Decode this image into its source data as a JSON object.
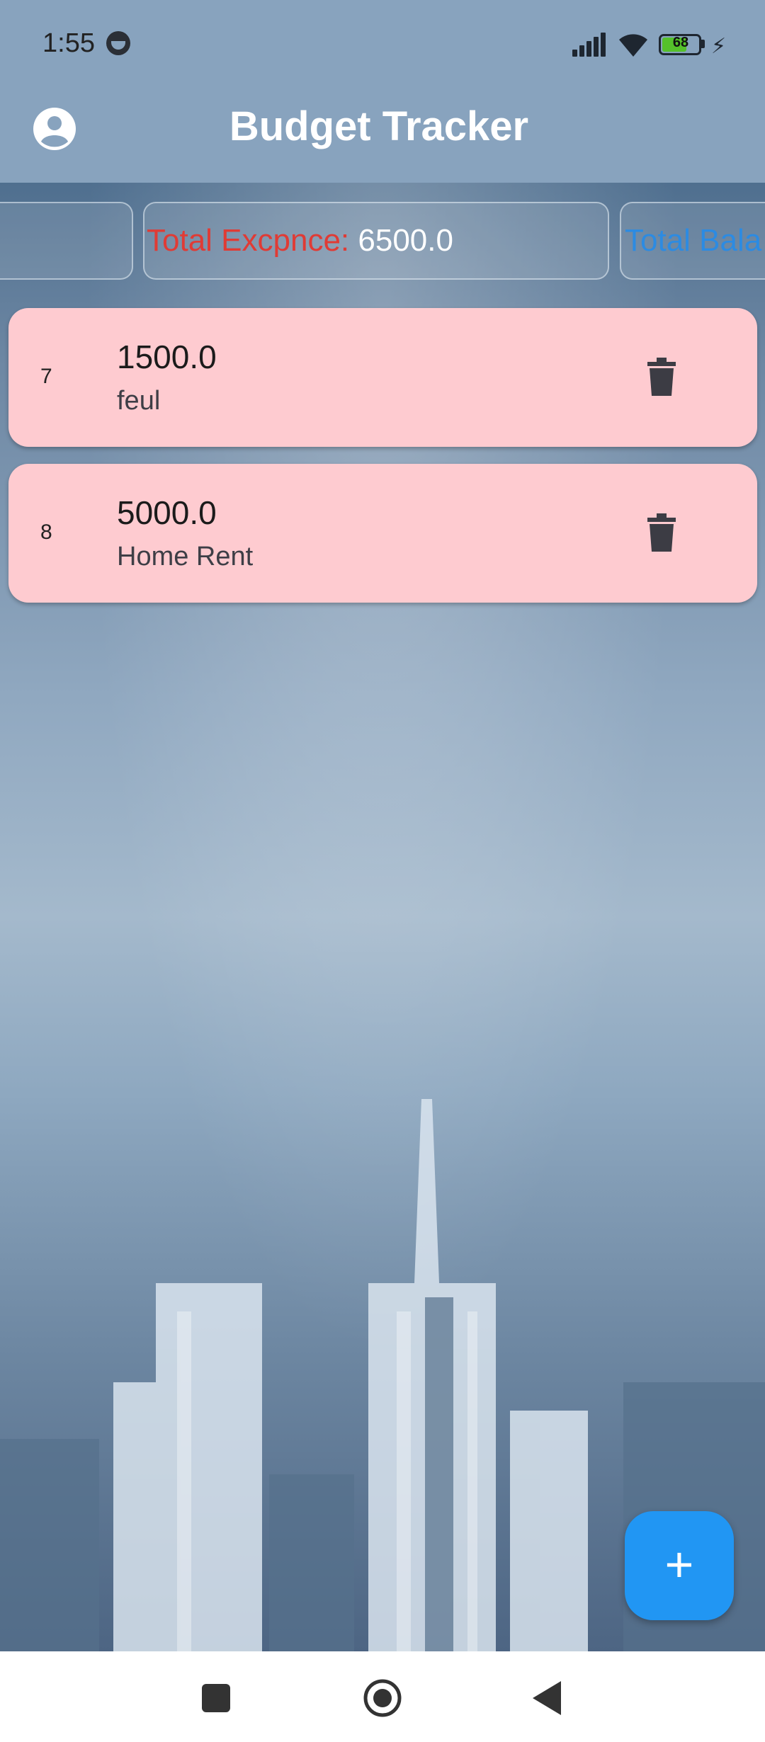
{
  "status_bar": {
    "time": "1:55",
    "battery_percent": "68",
    "battery_level": 0.68,
    "icons": [
      "face-icon",
      "signal-icon",
      "wifi-icon",
      "battery-icon",
      "charging-icon"
    ]
  },
  "app_bar": {
    "title": "Budget Tracker",
    "avatar_icon": "account-circle-icon"
  },
  "summary": {
    "expense_label": "Total Excpnce: ",
    "expense_value": "6500.0",
    "balance_label": "Total Bala"
  },
  "entries": [
    {
      "index": "7",
      "amount": "1500.0",
      "name": "feul",
      "action_icon": "delete-icon"
    },
    {
      "index": "8",
      "amount": "5000.0",
      "name": "Home Rent",
      "action_icon": "delete-icon"
    }
  ],
  "fab": {
    "label": "+",
    "icon": "add-icon"
  },
  "colors": {
    "app_bar": "#88a3be",
    "entry_card": "#fecbd0",
    "expense_label": "#e03b35",
    "balance_label": "#2c8be2",
    "fab": "#2196f3"
  },
  "nav": {
    "icons": [
      "recents-icon",
      "home-icon",
      "back-icon"
    ]
  }
}
